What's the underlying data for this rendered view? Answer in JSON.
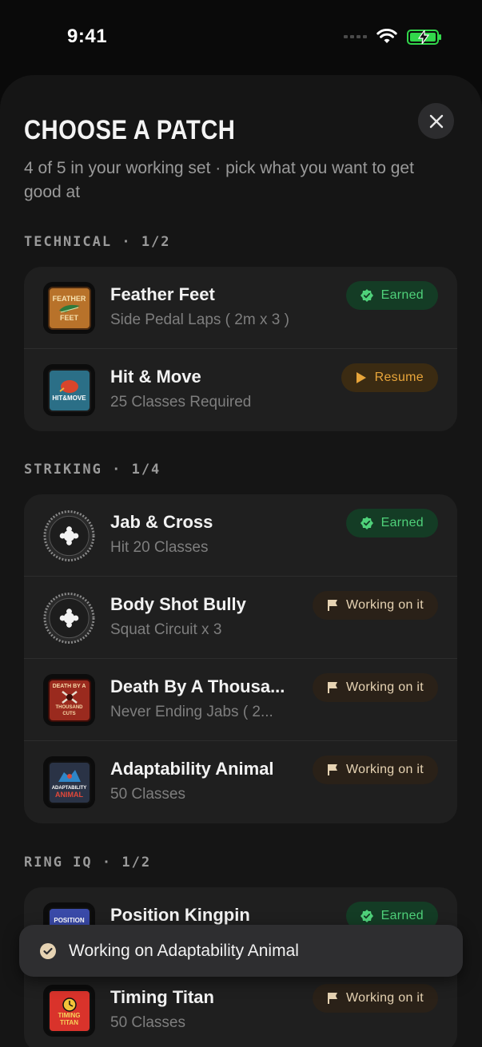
{
  "status": {
    "time": "9:41"
  },
  "sheet": {
    "title": "CHOOSE A PATCH",
    "subtitle": "4 of 5 in your working set · pick what you want to get good at"
  },
  "sections": [
    {
      "label": "TECHNICAL · 1/2",
      "items": [
        {
          "title": "Feather Feet",
          "subtitle": "Side Pedal Laps ( 2m x 3 )",
          "status": "Earned",
          "badge_text": [
            "FEATHER",
            "FEET"
          ]
        },
        {
          "title": "Hit & Move",
          "subtitle": "25 Classes Required",
          "status": "Resume",
          "badge_text": [
            "HIT&MOVE"
          ]
        }
      ]
    },
    {
      "label": "STRIKING · 1/4",
      "items": [
        {
          "title": "Jab & Cross",
          "subtitle": "Hit 20 Classes",
          "status": "Earned"
        },
        {
          "title": "Body Shot Bully",
          "subtitle": "Squat Circuit x 3",
          "status": "Working on it"
        },
        {
          "title": "Death By A Thousa...",
          "subtitle": "Never Ending Jabs ( 2...",
          "status": "Working on it",
          "badge_text": [
            "DEATH BY A",
            "THOUSAND CUTS"
          ]
        },
        {
          "title": "Adaptability Animal",
          "subtitle": "50 Classes",
          "status": "Working on it",
          "badge_text": [
            "ADAPTABILITY",
            "ANIMAL"
          ]
        }
      ]
    },
    {
      "label": "RING IQ · 1/2",
      "items": [
        {
          "title": "Position Kingpin",
          "subtitle": "",
          "status": "Earned",
          "badge_text": [
            "POSITION"
          ]
        },
        {
          "title": "Timing Titan",
          "subtitle": "50 Classes",
          "status": "Working on it",
          "badge_text": [
            "TIMING",
            "TITAN"
          ]
        }
      ]
    }
  ],
  "toast": {
    "text": "Working on Adaptability Animal"
  },
  "colors": {
    "earned": "#4fd17a",
    "resume": "#e8a53a",
    "working": "#e6d3b3",
    "sheet": "#151515",
    "card": "#1f1f1f"
  }
}
